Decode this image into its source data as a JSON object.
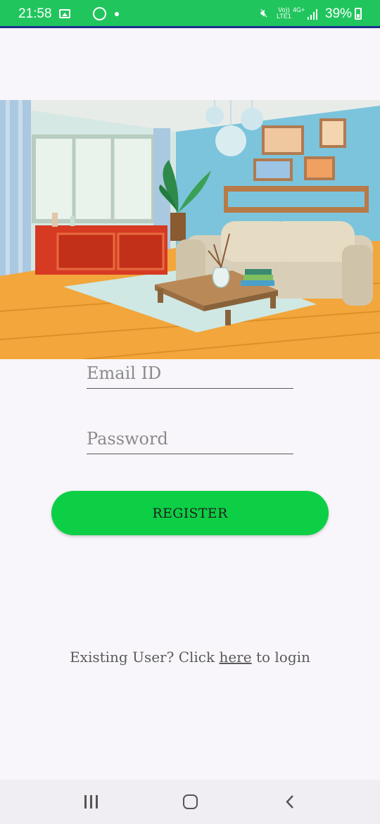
{
  "status_bar": {
    "time": "21:58",
    "icons": [
      "gallery-icon",
      "whatsapp-icon",
      "notification-dot-icon",
      "mute-icon",
      "volte-icon",
      "4g-icon",
      "signal-icon",
      "battery-icon"
    ],
    "volte_top": "Vo))",
    "volte_bottom": "LTE1",
    "network": "4G+",
    "battery": "39%"
  },
  "colors": {
    "status_bar": "#21c55d",
    "background": "#f8f6fa",
    "register_button": "#0dcf45"
  },
  "hero": {
    "description_icon": "living-room-illustration"
  },
  "form": {
    "email_placeholder": "Email ID",
    "email_value": "",
    "password_placeholder": "Password",
    "password_value": "",
    "register_label": "REGISTER"
  },
  "login_prompt": {
    "before": "Existing User? Click ",
    "link": "here",
    "after": " to login"
  },
  "nav_bar": {
    "icons": [
      "recents-icon",
      "home-icon",
      "back-icon"
    ]
  }
}
